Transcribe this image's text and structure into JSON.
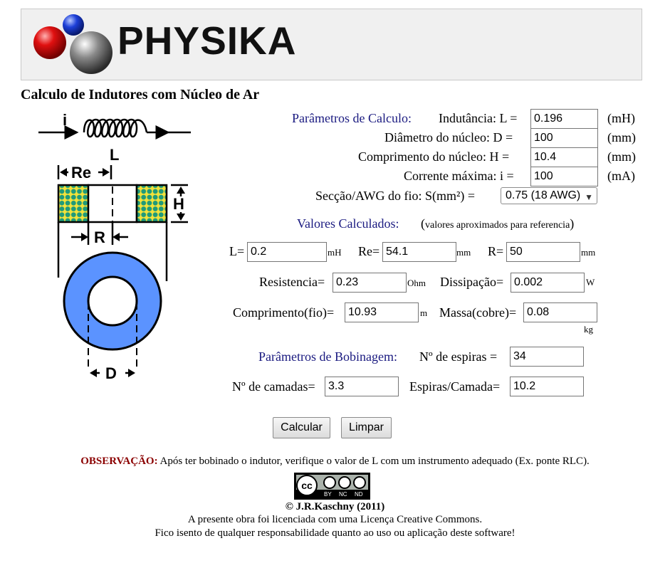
{
  "header": {
    "logo_text": "PHYSIKA"
  },
  "page_title": "Calculo de Indutores com Núcleo de Ar",
  "diagram": {
    "label_i": "i",
    "label_L": "L",
    "label_Re": "Re",
    "label_H": "H",
    "label_R": "R",
    "label_D": "D"
  },
  "params": {
    "section_label": "Parâmetros de Calculo:",
    "inductance": {
      "label": "Indutância: L =",
      "value": "0.196",
      "unit": "(mH)"
    },
    "diameter": {
      "label": "Diâmetro do núcleo: D =",
      "value": "100",
      "unit": "(mm)"
    },
    "length": {
      "label": "Comprimento do núcleo: H =",
      "value": "10.4",
      "unit": "(mm)"
    },
    "current": {
      "label": "Corrente máxima: i =",
      "value": "100",
      "unit": "(mA)"
    },
    "wire": {
      "label": "Secção/AWG do fio: S(mm²) =",
      "selected": "0.75 (18 AWG)"
    }
  },
  "calculated": {
    "section_label": "Valores Calculados:",
    "note": "(valores aproximados para referencia)",
    "note_open": "(",
    "note_text": "valores aproximados para referencia",
    "note_close": ")",
    "L": {
      "label": "L=",
      "value": "0.2",
      "unit": "mH"
    },
    "Re": {
      "label": "Re=",
      "value": "54.1",
      "unit": "mm"
    },
    "R": {
      "label": "R=",
      "value": "50",
      "unit": "mm"
    },
    "resistance": {
      "label": "Resistencia=",
      "value": "0.23",
      "unit": "Ohm"
    },
    "dissipation": {
      "label": "Dissipação=",
      "value": "0.002",
      "unit": "W"
    },
    "wire_length": {
      "label": "Comprimento(fio)=",
      "value": "10.93",
      "unit": "m"
    },
    "mass": {
      "label": "Massa(cobre)=",
      "value": "0.08",
      "unit": "kg"
    }
  },
  "winding": {
    "section_label": "Parâmetros de Bobinagem:",
    "turns": {
      "label": "Nº de espiras =",
      "value": "34"
    },
    "layers": {
      "label": "Nº de camadas=",
      "value": "3.3"
    },
    "turns_per_layer": {
      "label": "Espiras/Camada=",
      "value": "10.2"
    }
  },
  "buttons": {
    "calculate": "Calcular",
    "clear": "Limpar"
  },
  "footer": {
    "obs_label": "OBSERVAÇÃO:",
    "obs_text": "Após ter bobinado o indutor, verifique o valor de L com um instrumento adequado (Ex. ponte RLC).",
    "cc_badge": {
      "cc": "cc",
      "attrib": "BY",
      "nc": "NC",
      "nd": "ND"
    },
    "copyright": "© J.R.Kaschny (2011)",
    "license": "A presente obra foi licenciada com uma Licença Creative Commons.",
    "disclaimer": "Fico isento de qualquer responsabilidade quanto ao uso ou aplicação deste software!"
  },
  "colors": {
    "section_label": "#1a1a80",
    "observation": "#8b0000",
    "core_blue": "#5b93ff",
    "winding_green": "#1f9a7a",
    "winding_yellow": "#f3e23a"
  }
}
